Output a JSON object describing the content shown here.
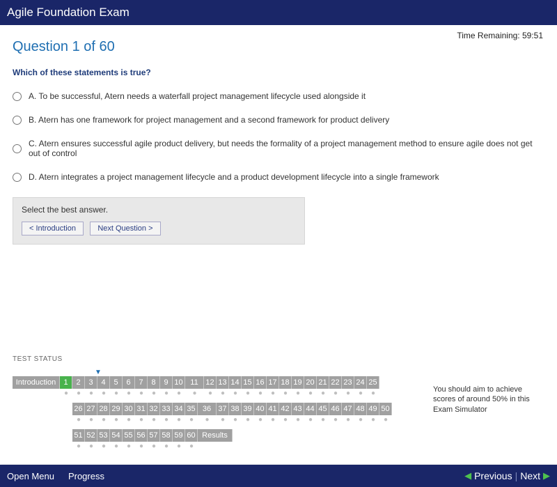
{
  "header": {
    "title": "Agile Foundation Exam"
  },
  "timer": {
    "label": "Time Remaining: 59:51"
  },
  "question": {
    "number_label": "Question 1 of 60",
    "text": "Which of these statements is true?",
    "answers": {
      "a": "A.   To be successful, Atern needs a waterfall project management lifecycle used alongside it",
      "b": "B.   Atern has one framework for project management and a second framework for product delivery",
      "c": "C.   Atern ensures successful agile product delivery, but needs the formality of a project management method to ensure agile does not get out of control",
      "d": "D.   Atern integrates a project management lifecycle and a product development lifecycle into a single framework"
    }
  },
  "instruct": {
    "text": "Select the best answer.",
    "prev": "< Introduction",
    "next": "Next Question >"
  },
  "status": {
    "label": "TEST STATUS",
    "intro": "Introduction",
    "results": "Results",
    "aim": "You should aim to achieve scores of around 50% in this Exam Simulator"
  },
  "footer": {
    "open_menu": "Open Menu",
    "progress": "Progress",
    "previous": "Previous",
    "next": "Next"
  }
}
